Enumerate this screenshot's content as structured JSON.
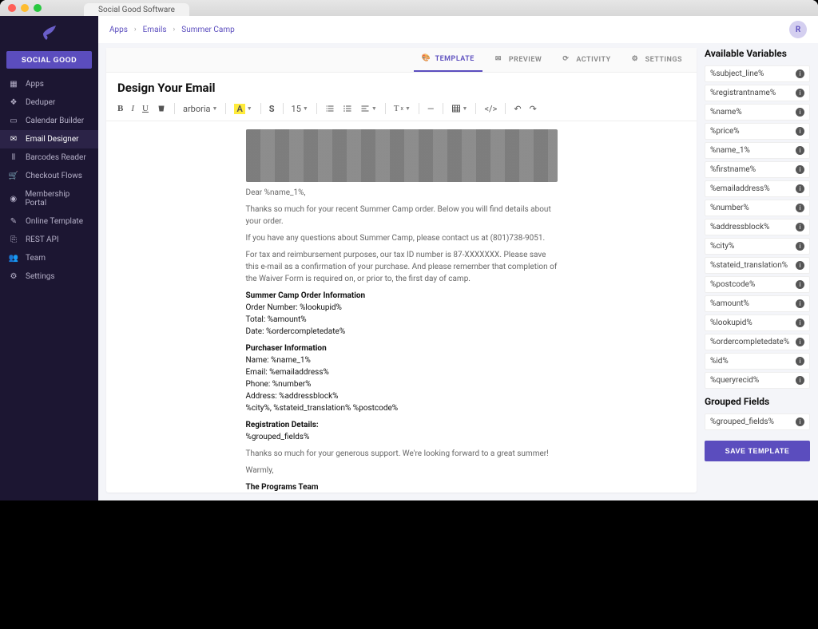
{
  "window": {
    "tab_title": "Social Good Software"
  },
  "sidebar": {
    "brand_button": "SOCIAL GOOD",
    "items": [
      {
        "label": "Apps",
        "icon": "grid"
      },
      {
        "label": "Deduper",
        "icon": "layers"
      },
      {
        "label": "Calendar Builder",
        "icon": "calendar"
      },
      {
        "label": "Email Designer",
        "icon": "mail",
        "active": true
      },
      {
        "label": "Barcodes Reader",
        "icon": "barcode"
      },
      {
        "label": "Checkout Flows",
        "icon": "cart"
      },
      {
        "label": "Membership Portal",
        "icon": "user-circle"
      },
      {
        "label": "Online Template",
        "icon": "pencil"
      },
      {
        "label": "REST API",
        "icon": "code"
      },
      {
        "label": "Team",
        "icon": "people"
      },
      {
        "label": "Settings",
        "icon": "gear"
      }
    ]
  },
  "topbar": {
    "breadcrumb": [
      "Apps",
      "Emails",
      "Summer Camp"
    ],
    "avatar_initial": "R"
  },
  "tabs": [
    {
      "label": "TEMPLATE",
      "icon": "palette",
      "active": true
    },
    {
      "label": "PREVIEW",
      "icon": "mail"
    },
    {
      "label": "ACTIVITY",
      "icon": "refresh"
    },
    {
      "label": "SETTINGS",
      "icon": "gear"
    }
  ],
  "editor": {
    "heading": "Design Your Email",
    "toolbar": {
      "font_name": "arboria",
      "font_size": "15",
      "text_color_letter": "A",
      "paragraph_letter": "T"
    },
    "body": {
      "greeting": "Dear %name_1%,",
      "intro": "Thanks so much for your recent Summer Camp order. Below you will find details about your order.",
      "contact_line": "If you have any questions about Summer Camp, please contact us at (801)738-9051.",
      "tax_line": "For tax and reimbursement purposes, our tax ID number is 87-XXXXXXX. Please save this e-mail as a confirmation of your purchase. And please remember that completion of the Waiver Form is required on, or prior to, the first day of camp.",
      "order_header": "Summer Camp Order Information",
      "order_number": "Order Number: %lookupid%",
      "order_total": "Total: %amount%",
      "order_date": "Date: %ordercompletedate%",
      "purchaser_header": "Purchaser Information",
      "purchaser_name": "Name: %name_1%",
      "purchaser_email": "Email: %emailaddress%",
      "purchaser_phone": "Phone: %number%",
      "purchaser_address": "Address: %addressblock%",
      "purchaser_citystate": "%city%, %stateid_translation% %postcode%",
      "reg_header": "Registration Details:",
      "reg_grouped": "%grouped_fields%",
      "closing": "Thanks so much for your generous support. We're looking forward to a great summer!",
      "signoff": "Warmly,",
      "signature": "The Programs Team"
    }
  },
  "variables": {
    "heading": "Available Variables",
    "list": [
      "%subject_line%",
      "%registrantname%",
      "%name%",
      "%price%",
      "%name_1%",
      "%firstname%",
      "%emailaddress%",
      "%number%",
      "%addressblock%",
      "%city%",
      "%stateid_translation%",
      "%postcode%",
      "%amount%",
      "%lookupid%",
      "%ordercompletedate%",
      "%id%",
      "%queryrecid%"
    ],
    "grouped_heading": "Grouped Fields",
    "grouped_list": [
      "%grouped_fields%"
    ],
    "save_label": "SAVE TEMPLATE"
  }
}
